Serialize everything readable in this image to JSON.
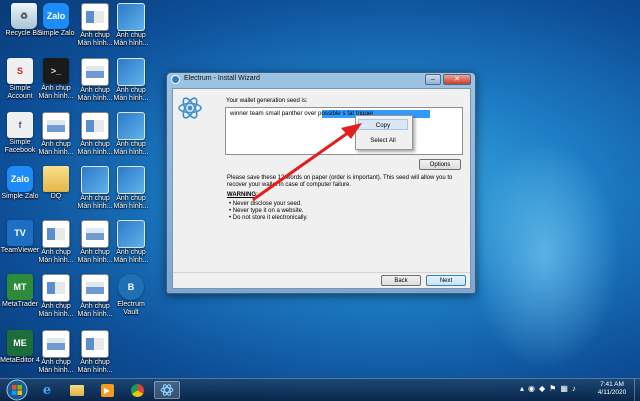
{
  "desktop": {
    "icons": [
      {
        "label": "Recycle Bin",
        "glyph": ""
      },
      {
        "label": "Simple Zalo",
        "glyph": "Zalo"
      },
      {
        "label": "Ảnh chụp Màn hình...",
        "glyph": ""
      },
      {
        "label": "Ảnh chụp Màn hình...",
        "glyph": ""
      },
      {
        "label": "Simple Account",
        "glyph": "S"
      },
      {
        "label": "Ảnh chụp Màn hình...",
        "glyph": ">_"
      },
      {
        "label": "Ảnh chụp Màn hình...",
        "glyph": ""
      },
      {
        "label": "Ảnh chụp Màn hình...",
        "glyph": ""
      },
      {
        "label": "Simple Facebook",
        "glyph": "f"
      },
      {
        "label": "Ảnh chụp Màn hình...",
        "glyph": ""
      },
      {
        "label": "Ảnh chụp Màn hình...",
        "glyph": ""
      },
      {
        "label": "Ảnh chụp Màn hình...",
        "glyph": ""
      },
      {
        "label": "Simple Zalo",
        "glyph": "Zalo"
      },
      {
        "label": "DQ",
        "glyph": ""
      },
      {
        "label": "Ảnh chụp Màn hình...",
        "glyph": ""
      },
      {
        "label": "Ảnh chụp Màn hình...",
        "glyph": ""
      },
      {
        "label": "TeamViewer",
        "glyph": "TV"
      },
      {
        "label": "Ảnh chụp Màn hình...",
        "glyph": ""
      },
      {
        "label": "Ảnh chụp Màn hình...",
        "glyph": ""
      },
      {
        "label": "Ảnh chụp Màn hình...",
        "glyph": ""
      },
      {
        "label": "MetaTrader",
        "glyph": "MT"
      },
      {
        "label": "Ảnh chụp Màn hình...",
        "glyph": ""
      },
      {
        "label": "Ảnh chụp Màn hình...",
        "glyph": ""
      },
      {
        "label": "Electrum Vault",
        "glyph": "B"
      },
      {
        "label": "MetaEditor 4",
        "glyph": "ME"
      },
      {
        "label": "Ảnh chụp Màn hình...",
        "glyph": ""
      },
      {
        "label": "Ảnh chụp Màn hình...",
        "glyph": ""
      }
    ]
  },
  "window": {
    "title": "Electrum  -  Install Wizard",
    "minimize": "–",
    "close": "✕",
    "seed_heading": "Your wallet generation seed is:",
    "seed_text": "winner team small panther over possible s              fat trigger",
    "options_label": "Options",
    "save_note": "Please save these 12 words on paper (order is important). This seed will allow you to recover your wallet in case of computer failure.",
    "warning_title": "WARNING:",
    "warnings": [
      "Never disclose your seed.",
      "Never type it on a website.",
      "Do not store it electronically."
    ],
    "back_label": "Back",
    "next_label": "Next"
  },
  "context_menu": {
    "items": [
      "Copy",
      "Select All"
    ],
    "highlighted": "Copy"
  },
  "annotation": {
    "arrow_color": "#e21f1f"
  },
  "taskbar": {
    "apps": [
      "internet-explorer-icon",
      "file-explorer-icon",
      "media-player-icon",
      "chrome-icon",
      "electrum-icon"
    ],
    "active_app": "electrum-icon",
    "time": "7:41 AM",
    "date": "4/11/2020"
  }
}
